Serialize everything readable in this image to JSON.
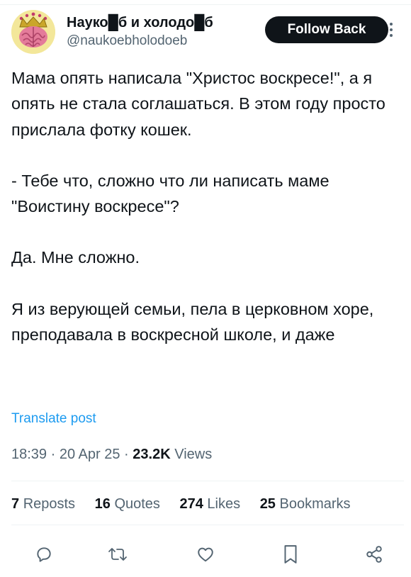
{
  "profile": {
    "display_name": "Науко█б и холодо█б",
    "handle": "@naukoebholodoeb",
    "avatar_icon": "brain-crown-avatar"
  },
  "header": {
    "follow_label": "Follow Back",
    "more_icon": "more-icon"
  },
  "tweet": {
    "paragraphs": [
      "Мама опять написала \"Христос воскресе!\", а я опять не стала соглашаться. В этом году просто прислала фотку кошек.",
      "",
      "- Тебе что, сложно что ли написать маме \"Воистину воскресе\"?",
      "",
      "Да. Мне сложно.",
      "",
      "Я из верующей семьи, пела в церковном хоре, преподавала в воскресной школе, и даже"
    ],
    "translate_label": "Translate post"
  },
  "meta": {
    "time": "18:39",
    "date": "20 Apr 25",
    "views_count": "23.2K",
    "views_label": "Views",
    "separator": "·"
  },
  "stats": {
    "reposts": {
      "count": "7",
      "label": "Reposts"
    },
    "quotes": {
      "count": "16",
      "label": "Quotes"
    },
    "likes": {
      "count": "274",
      "label": "Likes"
    },
    "bookmarks": {
      "count": "25",
      "label": "Bookmarks"
    }
  },
  "actions": [
    "reply-icon",
    "repost-icon",
    "like-icon",
    "bookmark-icon",
    "share-icon"
  ],
  "colors": {
    "text": "#0f1419",
    "secondary": "#536471",
    "link": "#1d9bf0",
    "button": "#0f1419",
    "divider": "#eff3f4"
  }
}
